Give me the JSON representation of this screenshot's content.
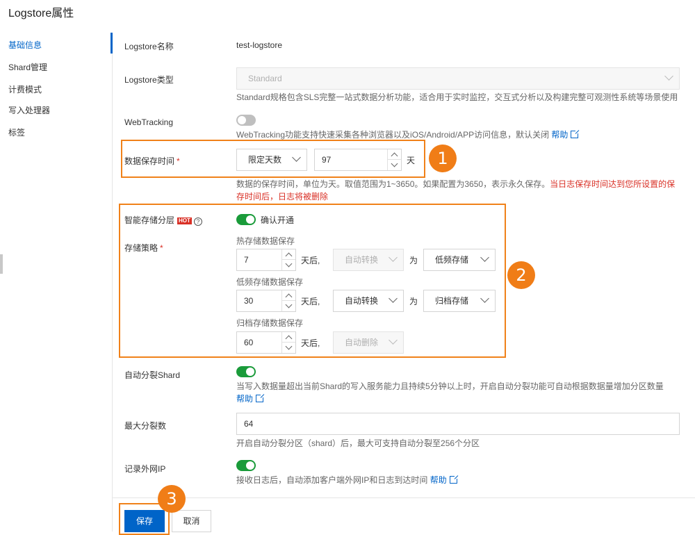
{
  "page_title": "Logstore属性",
  "nav": {
    "items": [
      "基础信息",
      "Shard管理",
      "计费模式",
      "写入处理器",
      "标签"
    ]
  },
  "form": {
    "name": {
      "label": "Logstore名称",
      "value": "test-logstore"
    },
    "type": {
      "label": "Logstore类型",
      "value": "Standard",
      "hint": "Standard规格包含SLS完整一站式数据分析功能，适合用于实时监控，交互式分析以及构建完整可观测性系统等场景使用"
    },
    "webtracking": {
      "label": "WebTracking",
      "hint": "WebTracking功能支持快速采集各种浏览器以及iOS/Android/APP访问信息，默认关闭",
      "help": "帮助"
    },
    "retention": {
      "label": "数据保存时间",
      "required_mark": "*",
      "mode": "限定天数",
      "days": "97",
      "unit": "天",
      "hint": "数据的保存时间，单位为天。取值范围为1~3650。如果配置为3650，表示永久保存。",
      "warning_line1": "当日志保存时间达到您所设置的保",
      "warning_line2": "存时间后，日志将被删除"
    },
    "tiering": {
      "label": "智能存储分层",
      "hot_badge": "HOT",
      "help_glyph": "?",
      "toggle_label": "确认开通",
      "policy_label": "存储策略",
      "required_mark": "*",
      "hot": {
        "title": "热存储数据保存",
        "days": "7",
        "after": "天后,",
        "action": "自动转换",
        "to": "为",
        "target": "低频存储"
      },
      "ia": {
        "title": "低频存储数据保存",
        "days": "30",
        "after": "天后,",
        "action": "自动转换",
        "to": "为",
        "target": "归档存储"
      },
      "archive": {
        "title": "归档存储数据保存",
        "days": "60",
        "after": "天后,",
        "action": "自动删除"
      }
    },
    "auto_split": {
      "label": "自动分裂Shard",
      "hint": "当写入数据量超出当前Shard的写入服务能力且持续5分钟以上时，开启自动分裂功能可自动根据数据量增加分区数量",
      "help": "帮助"
    },
    "max_split": {
      "label": "最大分裂数",
      "value": "64",
      "hint": "开启自动分裂分区（shard）后，最大可支持自动分裂至256个分区"
    },
    "record_ip": {
      "label": "记录外网IP",
      "hint": "接收日志后，自动添加客户端外网IP和日志到达时间",
      "help": "帮助"
    }
  },
  "footer": {
    "save": "保存",
    "cancel": "取消"
  },
  "annotations": [
    "1",
    "2",
    "3"
  ],
  "colors": {
    "primary": "#0064c8",
    "toggle_on": "#1a9b3a",
    "annotation": "#f07d17",
    "danger": "#d93026"
  }
}
